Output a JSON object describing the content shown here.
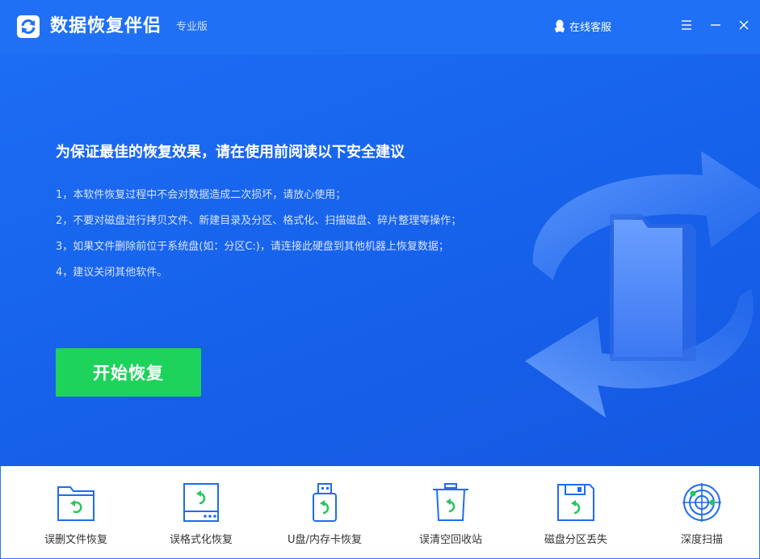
{
  "app": {
    "title": "数据恢复伴侣",
    "edition": "专业版",
    "support_label": "在线客服"
  },
  "hero": {
    "headline": "为保证最佳的恢复效果，请在使用前阅读以下安全建议",
    "tips": [
      "1，本软件恢复过程中不会对数据造成二次损坏，请放心使用；",
      "2，不要对磁盘进行拷贝文件、新建目录及分区、格式化、扫描磁盘、碎片整理等操作；",
      "3，如果文件删除前位于系统盘(如：分区C:)，请连接此硬盘到其他机器上恢复数据；",
      "4，建议关闭其他软件。"
    ],
    "start_label": "开始恢复"
  },
  "modes": [
    {
      "label": "误删文件恢复",
      "icon": "folder-recover-icon"
    },
    {
      "label": "误格式化恢复",
      "icon": "drive-format-recover-icon"
    },
    {
      "label": "U盘/内存卡恢复",
      "icon": "usb-recover-icon"
    },
    {
      "label": "误清空回收站",
      "icon": "recycle-bin-recover-icon"
    },
    {
      "label": "磁盘分区丢失",
      "icon": "partition-recover-icon"
    },
    {
      "label": "深度扫描",
      "icon": "radar-scan-icon"
    }
  ],
  "colors": {
    "accent": "#1f70f5",
    "start_button": "#1ed35b",
    "icon_stroke": "#1f6cf0",
    "icon_arrow": "#25c75a"
  }
}
